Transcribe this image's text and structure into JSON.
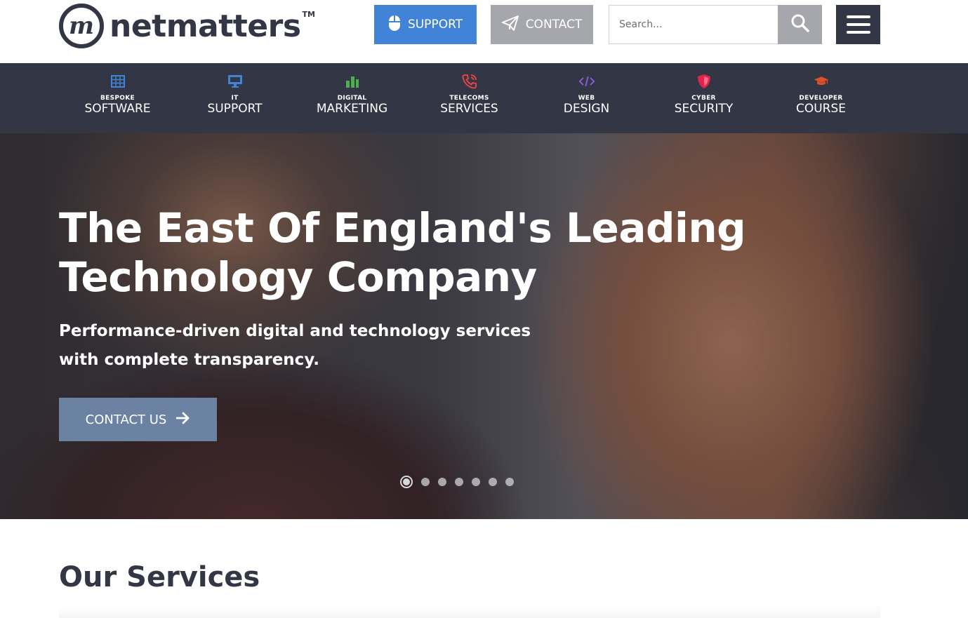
{
  "header": {
    "logo_mark": "m",
    "logo_text": "netmatters",
    "logo_tm": "TM",
    "support_label": "SUPPORT",
    "contact_label": "CONTACT",
    "search_placeholder": "Search...",
    "support_color": "#4183d7",
    "contact_color": "#a6a6ad",
    "menu_color": "#333645"
  },
  "nav": {
    "items": [
      {
        "small": "BESPOKE",
        "big": "SOFTWARE",
        "icon": "grid-icon",
        "color": "#4183d7"
      },
      {
        "small": "IT",
        "big": "SUPPORT",
        "icon": "monitor-icon",
        "color": "#4183d7"
      },
      {
        "small": "DIGITAL",
        "big": "MARKETING",
        "icon": "bar-chart-icon",
        "color": "#4caf50"
      },
      {
        "small": "TELECOMS",
        "big": "SERVICES",
        "icon": "phone-icon",
        "color": "#e04444"
      },
      {
        "small": "WEB",
        "big": "DESIGN",
        "icon": "code-icon",
        "color": "#8e5cd9"
      },
      {
        "small": "CYBER",
        "big": "SECURITY",
        "icon": "shield-icon",
        "color": "#e0244a"
      },
      {
        "small": "DEVELOPER",
        "big": "COURSE",
        "icon": "graduation-cap-icon",
        "color": "#e04f2c"
      }
    ]
  },
  "hero": {
    "title_line1": "The East Of England's Leading",
    "title_line2": "Technology Company",
    "subtitle_line1": "Performance-driven digital and technology services",
    "subtitle_line2": "with complete transparency.",
    "cta_label": "CONTACT US",
    "slides_count": 7,
    "active_slide": 1
  },
  "services": {
    "title": "Our Services"
  }
}
